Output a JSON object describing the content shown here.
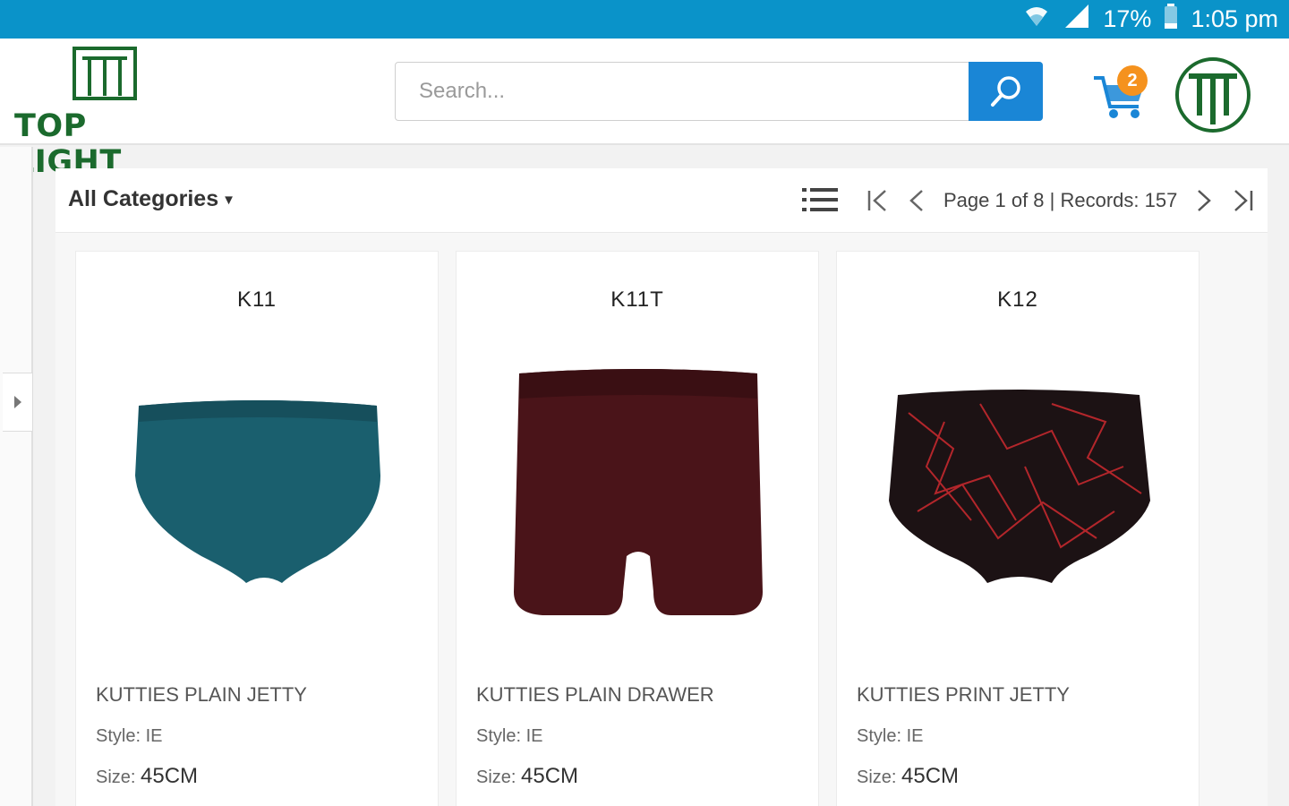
{
  "status_bar": {
    "battery": "17%",
    "time": "1:05 pm",
    "icons": [
      "wifi-icon",
      "signal-icon",
      "battery-icon"
    ]
  },
  "header": {
    "brand": "TOP LIGHT",
    "search_placeholder": "Search...",
    "cart_count": "2",
    "colors": {
      "brand_green": "#1b6a2d",
      "accent_blue": "#1a86d6",
      "status_blue": "#0a93c9",
      "badge_orange": "#f5921e"
    }
  },
  "toolbar": {
    "category_label": "All Categories",
    "pager_text": "Page 1 of 8 | Records: 157"
  },
  "products": [
    {
      "code": "K11",
      "name": "KUTTIES PLAIN JETTY",
      "style_label": "Style:",
      "style": "IE",
      "size_label": "Size:",
      "size": "45CM",
      "color": "#1a5f6e"
    },
    {
      "code": "K11T",
      "name": "KUTTIES PLAIN DRAWER",
      "style_label": "Style:",
      "style": "IE",
      "size_label": "Size:",
      "size": "45CM",
      "color": "#4a1419"
    },
    {
      "code": "K12",
      "name": "KUTTIES PRINT JETTY",
      "style_label": "Style:",
      "style": "IE",
      "size_label": "Size:",
      "size": "45CM",
      "color": "#1c1214"
    }
  ]
}
